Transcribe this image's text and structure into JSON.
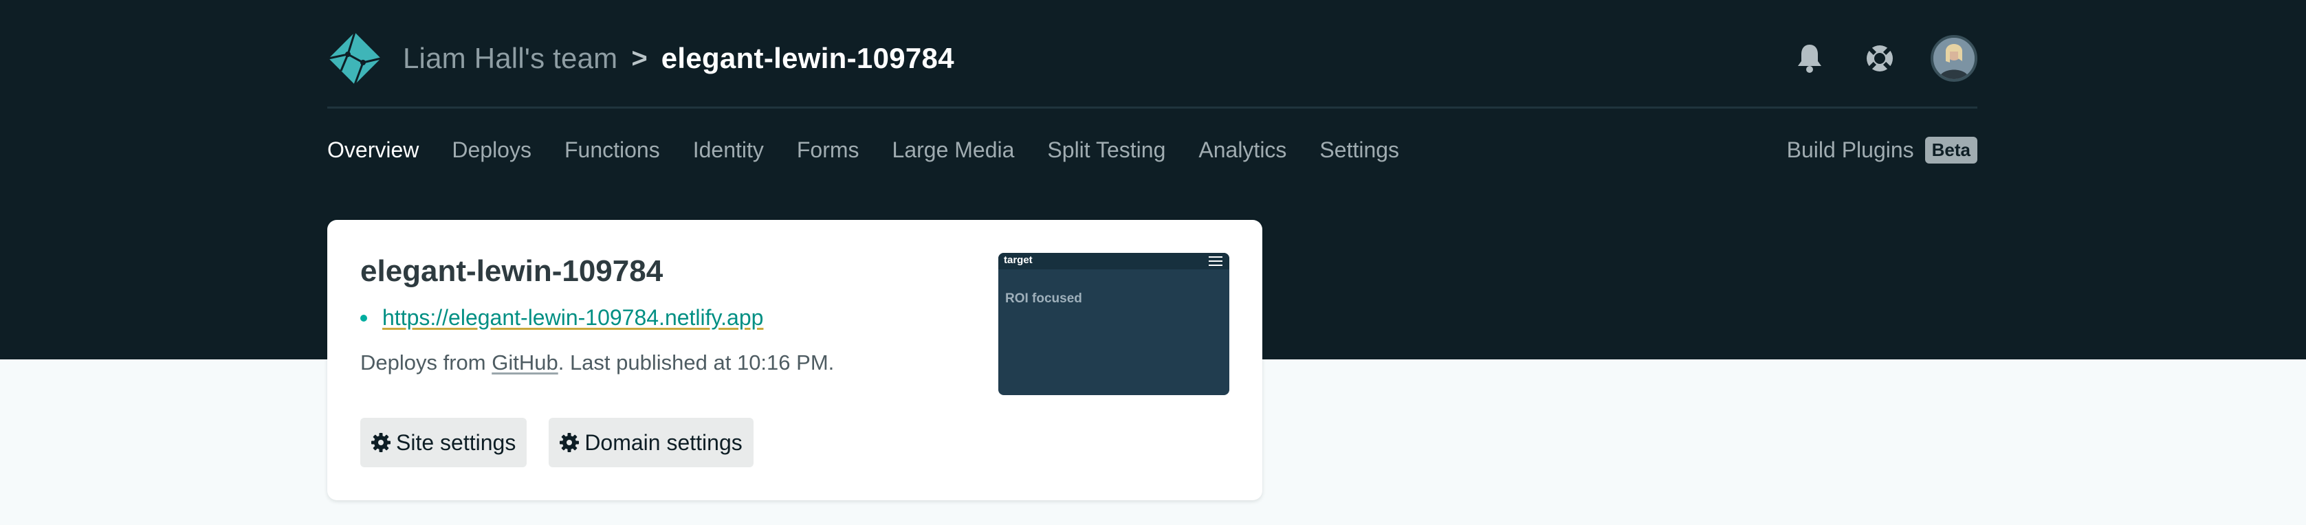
{
  "header": {
    "team_name": "Liam Hall's team",
    "separator": ">",
    "site_name": "elegant-lewin-109784",
    "icons": [
      "notification-bell-icon",
      "help-lifebuoy-icon",
      "user-avatar"
    ]
  },
  "nav": {
    "items": [
      {
        "label": "Overview",
        "active": true
      },
      {
        "label": "Deploys"
      },
      {
        "label": "Functions"
      },
      {
        "label": "Identity"
      },
      {
        "label": "Forms"
      },
      {
        "label": "Large Media"
      },
      {
        "label": "Split Testing"
      },
      {
        "label": "Analytics"
      },
      {
        "label": "Settings"
      }
    ],
    "build_plugins": "Build Plugins",
    "beta": "Beta"
  },
  "card": {
    "title": "elegant-lewin-109784",
    "url": "https://elegant-lewin-109784.netlify.app",
    "deploy_prefix": "Deploys from ",
    "deploy_source": "GitHub",
    "deploy_suffix": ". Last published at 10:16 PM.",
    "site_settings_label": "Site settings",
    "domain_settings_label": "Domain settings",
    "thumbnail": {
      "logo_text": "target",
      "hero_text": "ROI focused"
    }
  },
  "colors": {
    "header_bg": "#0e1e25",
    "accent_teal": "#00ad9f",
    "page_bg": "#f6fafb"
  }
}
